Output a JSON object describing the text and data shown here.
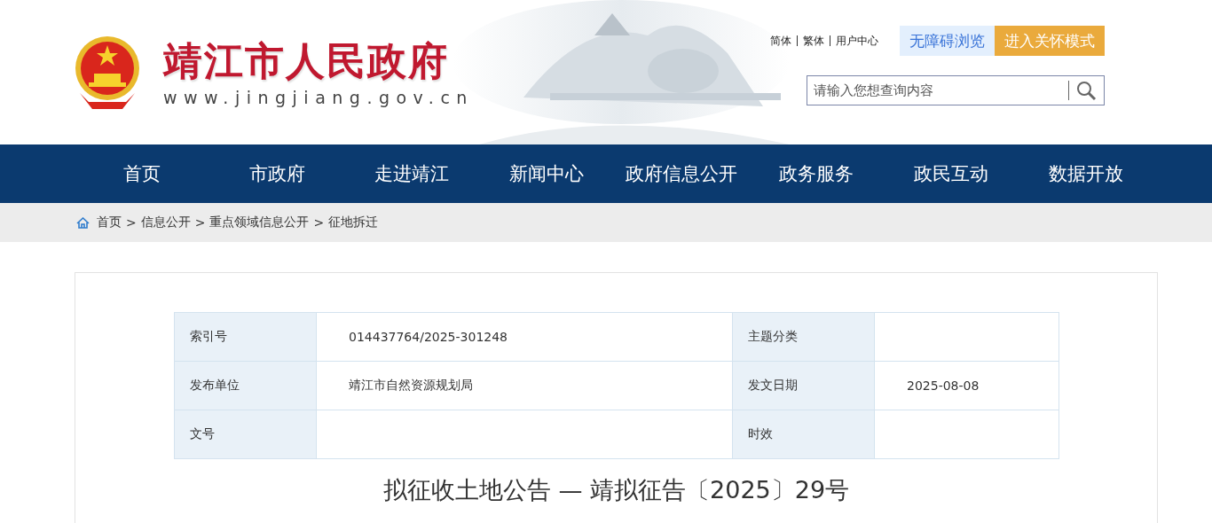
{
  "header": {
    "site_name": "靖江市人民政府",
    "site_url": "www.jingjiang.gov.cn",
    "top_links": [
      "简体",
      "繁体",
      "用户中心"
    ],
    "accessibility_button": "无障碍浏览",
    "care_mode_button": "进入关怀模式",
    "search": {
      "placeholder": "请输入您想查询内容"
    }
  },
  "nav": [
    {
      "label": "首页"
    },
    {
      "label": "市政府"
    },
    {
      "label": "走进靖江"
    },
    {
      "label": "新闻中心"
    },
    {
      "label": "政府信息公开"
    },
    {
      "label": "政务服务"
    },
    {
      "label": "政民互动"
    },
    {
      "label": "数据开放"
    }
  ],
  "breadcrumb": {
    "separator": ">",
    "items": [
      "首页",
      "信息公开",
      "重点领域信息公开",
      "征地拆迁"
    ]
  },
  "meta_table": [
    [
      {
        "label": "索引号",
        "value": "014437764/2025-301248"
      },
      {
        "label": "主题分类"
      }
    ],
    [
      {
        "label": "发布单位",
        "value": "靖江市自然资源规划局"
      },
      {
        "label": "发文日期",
        "value": "2025-08-08"
      }
    ],
    [
      {
        "label": "文号"
      },
      {
        "label": "时效"
      }
    ]
  ],
  "article_title": "拟征收土地公告 — 靖拟征告〔2025〕29号"
}
